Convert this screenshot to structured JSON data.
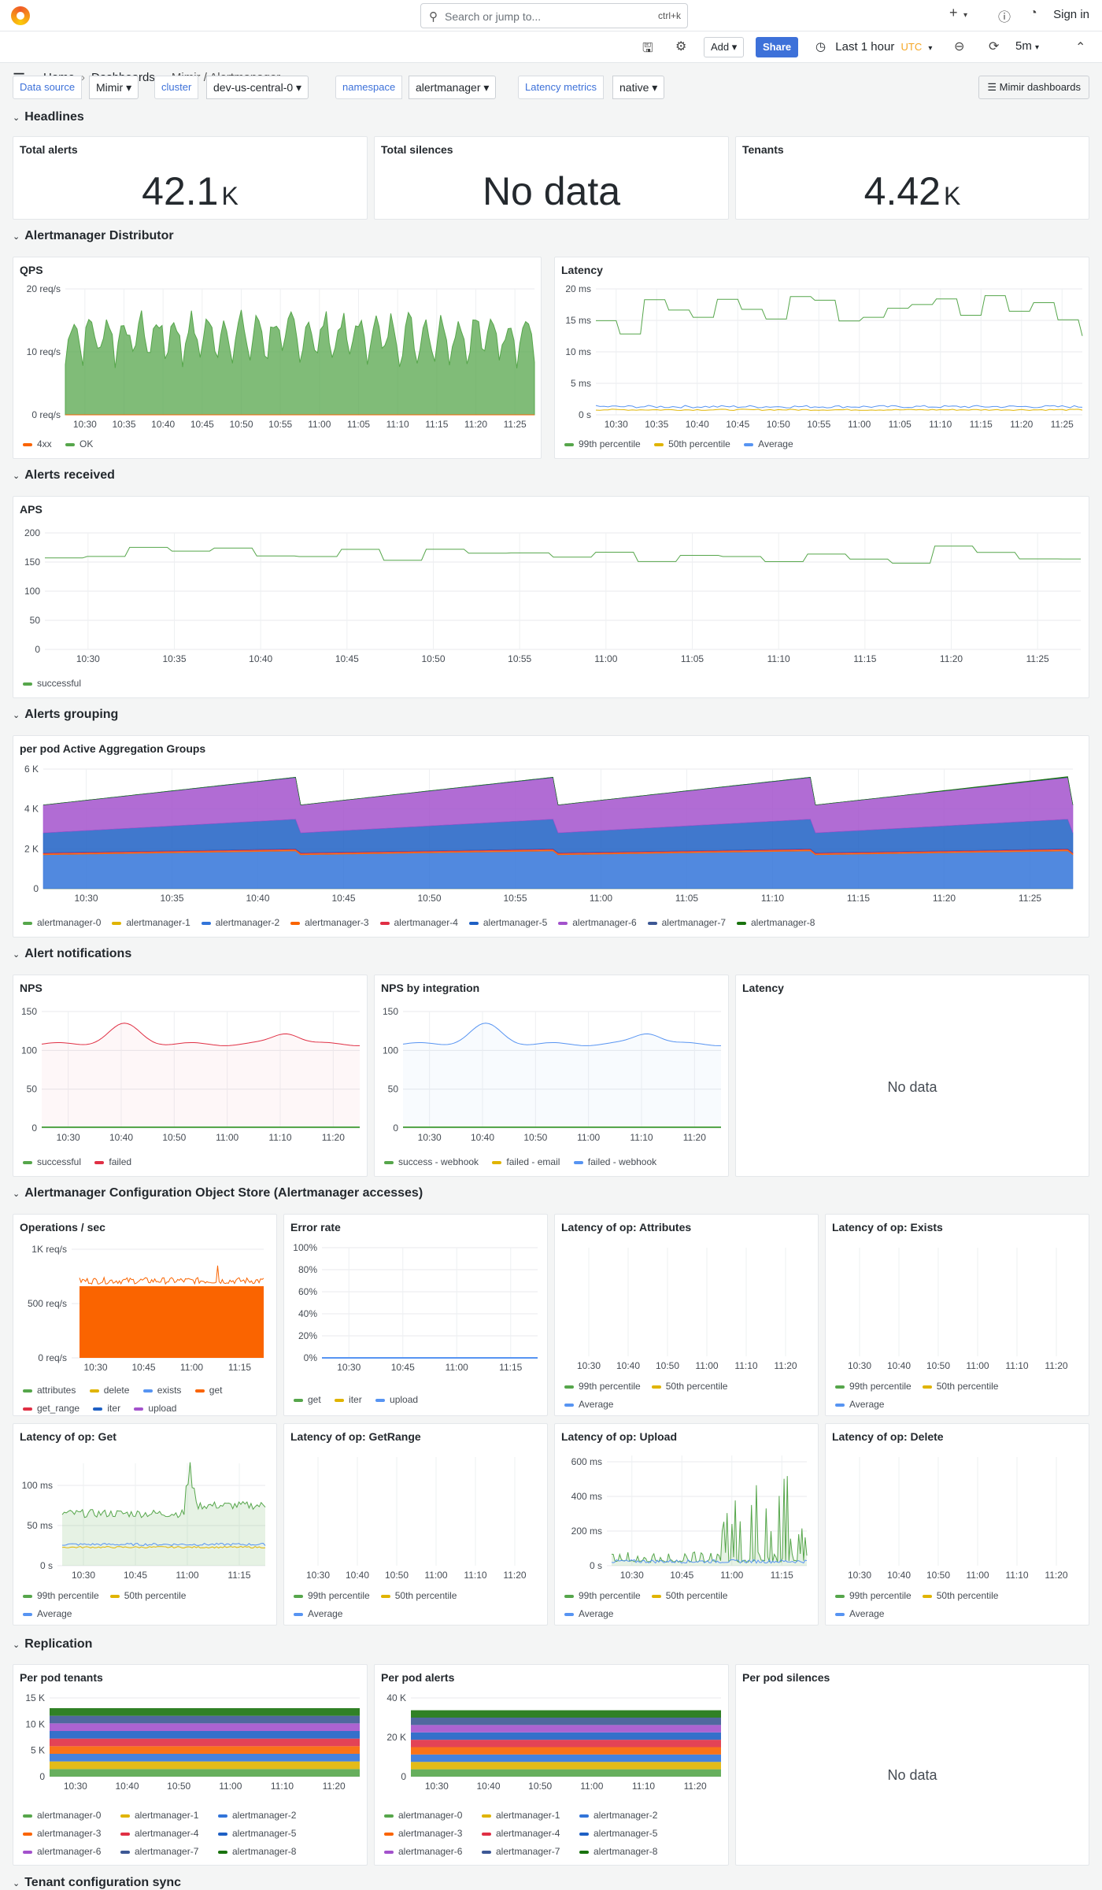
{
  "topbar": {
    "search_placeholder": "Search or jump to...",
    "search_shortcut": "ctrl+k",
    "plus": "+",
    "signin": "Sign in"
  },
  "breadcrumb": {
    "home": "Home",
    "dashboards": "Dashboards",
    "current": "Mimir / Alertmanager"
  },
  "toolbar": {
    "add": "Add",
    "share": "Share",
    "time_range": "Last 1 hour",
    "timezone": "UTC",
    "refresh": "5m"
  },
  "variables": [
    {
      "label": "Data source",
      "value": "Mimir"
    },
    {
      "label": "cluster",
      "value": "dev-us-central-0"
    },
    {
      "label": "namespace",
      "value": "alertmanager"
    },
    {
      "label": "Latency metrics",
      "value": "native"
    }
  ],
  "mimir_dashboards": "Mimir dashboards",
  "rows": {
    "headlines": "Headlines",
    "distributor": "Alertmanager Distributor",
    "received": "Alerts received",
    "grouping": "Alerts grouping",
    "notifications": "Alert notifications",
    "object_store": "Alertmanager Configuration Object Store (Alertmanager accesses)",
    "replication": "Replication",
    "tenant_sync": "Tenant configuration sync"
  },
  "stats": {
    "total_alerts": {
      "title": "Total alerts",
      "value": "42.1",
      "unit": "K"
    },
    "total_silences": {
      "title": "Total silences",
      "value": "No data"
    },
    "tenants": {
      "title": "Tenants",
      "value": "4.42",
      "unit": "K"
    }
  },
  "colors": {
    "green": "#56a64b",
    "yellow": "#e0b400",
    "blue": "#3274d9",
    "orange": "#fa6400",
    "red": "#e02f44",
    "purple": "#a352cc",
    "darkgreen": "#19730e",
    "darkblue": "#1f60c4",
    "violet": "#8f3bb8",
    "navy": "#3d5895"
  },
  "panels": {
    "qps": {
      "title": "QPS",
      "legend": [
        "4xx",
        "OK"
      ]
    },
    "latency": {
      "title": "Latency",
      "legend": [
        "99th percentile",
        "50th percentile",
        "Average"
      ]
    },
    "aps": {
      "title": "APS",
      "legend": [
        "successful"
      ]
    },
    "agg": {
      "title": "per pod Active Aggregation Groups",
      "legend": [
        "alertmanager-0",
        "alertmanager-1",
        "alertmanager-2",
        "alertmanager-3",
        "alertmanager-4",
        "alertmanager-5",
        "alertmanager-6",
        "alertmanager-7",
        "alertmanager-8"
      ]
    },
    "nps": {
      "title": "NPS",
      "legend": [
        "successful",
        "failed"
      ]
    },
    "nps_int": {
      "title": "NPS by integration",
      "legend": [
        "success - webhook",
        "failed - email",
        "failed - webhook"
      ]
    },
    "notif_latency": {
      "title": "Latency",
      "nodata": "No data"
    },
    "ops": {
      "title": "Operations / sec",
      "legend": [
        "attributes",
        "delete",
        "exists",
        "get",
        "get_range",
        "iter",
        "upload"
      ]
    },
    "errrate": {
      "title": "Error rate",
      "legend": [
        "get",
        "iter",
        "upload"
      ]
    },
    "lat_attr": {
      "title": "Latency of op: Attributes"
    },
    "lat_exists": {
      "title": "Latency of op: Exists"
    },
    "lat_get": {
      "title": "Latency of op: Get"
    },
    "lat_getrange": {
      "title": "Latency of op: GetRange"
    },
    "lat_upload": {
      "title": "Latency of op: Upload"
    },
    "lat_delete": {
      "title": "Latency of op: Delete"
    },
    "pct_legend": [
      "99th percentile",
      "50th percentile",
      "Average"
    ],
    "tenants": {
      "title": "Per pod tenants"
    },
    "alerts": {
      "title": "Per pod alerts"
    },
    "silences": {
      "title": "Per pod silences",
      "nodata": "No data"
    }
  },
  "chart_data": [
    {
      "type": "area",
      "title": "QPS",
      "ylim": [
        0,
        25
      ],
      "yticks": [
        "0 req/s",
        "10 req/s",
        "20 req/s"
      ],
      "xticks": [
        "10:30",
        "10:35",
        "10:40",
        "10:45",
        "10:50",
        "10:55",
        "11:00",
        "11:05",
        "11:10",
        "11:15",
        "11:20",
        "11:25"
      ],
      "series": [
        {
          "name": "OK",
          "range": [
            5,
            22
          ]
        },
        {
          "name": "4xx",
          "values": [
            0
          ]
        }
      ]
    },
    {
      "type": "line",
      "title": "Latency",
      "yticks": [
        "0 s",
        "5 ms",
        "10 ms",
        "15 ms",
        "20 ms"
      ],
      "xticks": [
        "10:30",
        "10:35",
        "10:40",
        "10:45",
        "10:50",
        "10:55",
        "11:00",
        "11:05",
        "11:10",
        "11:15",
        "11:20",
        "11:25"
      ],
      "series": [
        {
          "name": "99th percentile",
          "range": [
            12,
            20
          ]
        },
        {
          "name": "50th percentile",
          "values": [
            0.8
          ]
        },
        {
          "name": "Average",
          "values": [
            1.2
          ]
        }
      ]
    },
    {
      "type": "line",
      "title": "APS",
      "yticks": [
        "0",
        "50",
        "100",
        "150",
        "200"
      ],
      "xticks": [
        "10:30",
        "10:35",
        "10:40",
        "10:45",
        "10:50",
        "10:55",
        "11:00",
        "11:05",
        "11:10",
        "11:15",
        "11:20",
        "11:25"
      ],
      "series": [
        {
          "name": "successful",
          "range": [
            145,
            180
          ]
        }
      ]
    },
    {
      "type": "area",
      "title": "per pod Active Aggregation Groups",
      "yticks": [
        "0",
        "2 K",
        "4 K",
        "6 K"
      ],
      "xticks": [
        "10:30",
        "10:35",
        "10:40",
        "10:45",
        "10:50",
        "10:55",
        "11:00",
        "11:05",
        "11:10",
        "11:15",
        "11:20",
        "11:25"
      ]
    },
    {
      "type": "line",
      "title": "NPS",
      "yticks": [
        "0",
        "50",
        "100",
        "150"
      ],
      "xticks": [
        "10:30",
        "10:40",
        "10:50",
        "11:00",
        "11:10",
        "11:20"
      ],
      "series": [
        {
          "name": "successful",
          "range": [
            105,
            135
          ]
        },
        {
          "name": "failed",
          "values": [
            0
          ]
        }
      ]
    },
    {
      "type": "line",
      "title": "NPS by integration",
      "yticks": [
        "0",
        "50",
        "100",
        "150"
      ],
      "xticks": [
        "10:30",
        "10:40",
        "10:50",
        "11:00",
        "11:10",
        "11:20"
      ]
    },
    {
      "type": "area",
      "title": "Operations / sec",
      "yticks": [
        "0 req/s",
        "500 req/s",
        "1K req/s"
      ],
      "xticks": [
        "10:30",
        "10:45",
        "11:00",
        "11:15"
      ]
    },
    {
      "type": "line",
      "title": "Error rate",
      "yticks": [
        "0%",
        "20%",
        "40%",
        "60%",
        "80%",
        "100%"
      ],
      "xticks": [
        "10:30",
        "10:45",
        "11:00",
        "11:15"
      ]
    },
    {
      "type": "line",
      "title": "Latency of op: Get",
      "yticks": [
        "0 s",
        "50 ms",
        "100 ms"
      ],
      "xticks": [
        "10:30",
        "10:45",
        "11:00",
        "11:15"
      ]
    },
    {
      "type": "line",
      "title": "Latency of op: Upload",
      "yticks": [
        "0 s",
        "200 ms",
        "400 ms",
        "600 ms"
      ],
      "xticks": [
        "10:30",
        "10:45",
        "11:00",
        "11:15"
      ]
    },
    {
      "type": "area",
      "title": "Per pod tenants",
      "yticks": [
        "0",
        "5 K",
        "10 K",
        "15 K"
      ],
      "xticks": [
        "10:30",
        "10:40",
        "10:50",
        "11:00",
        "11:10",
        "11:20"
      ]
    },
    {
      "type": "area",
      "title": "Per pod alerts",
      "yticks": [
        "0",
        "20 K",
        "40 K"
      ],
      "xticks": [
        "10:30",
        "10:40",
        "10:50",
        "11:00",
        "11:10",
        "11:20"
      ]
    }
  ]
}
